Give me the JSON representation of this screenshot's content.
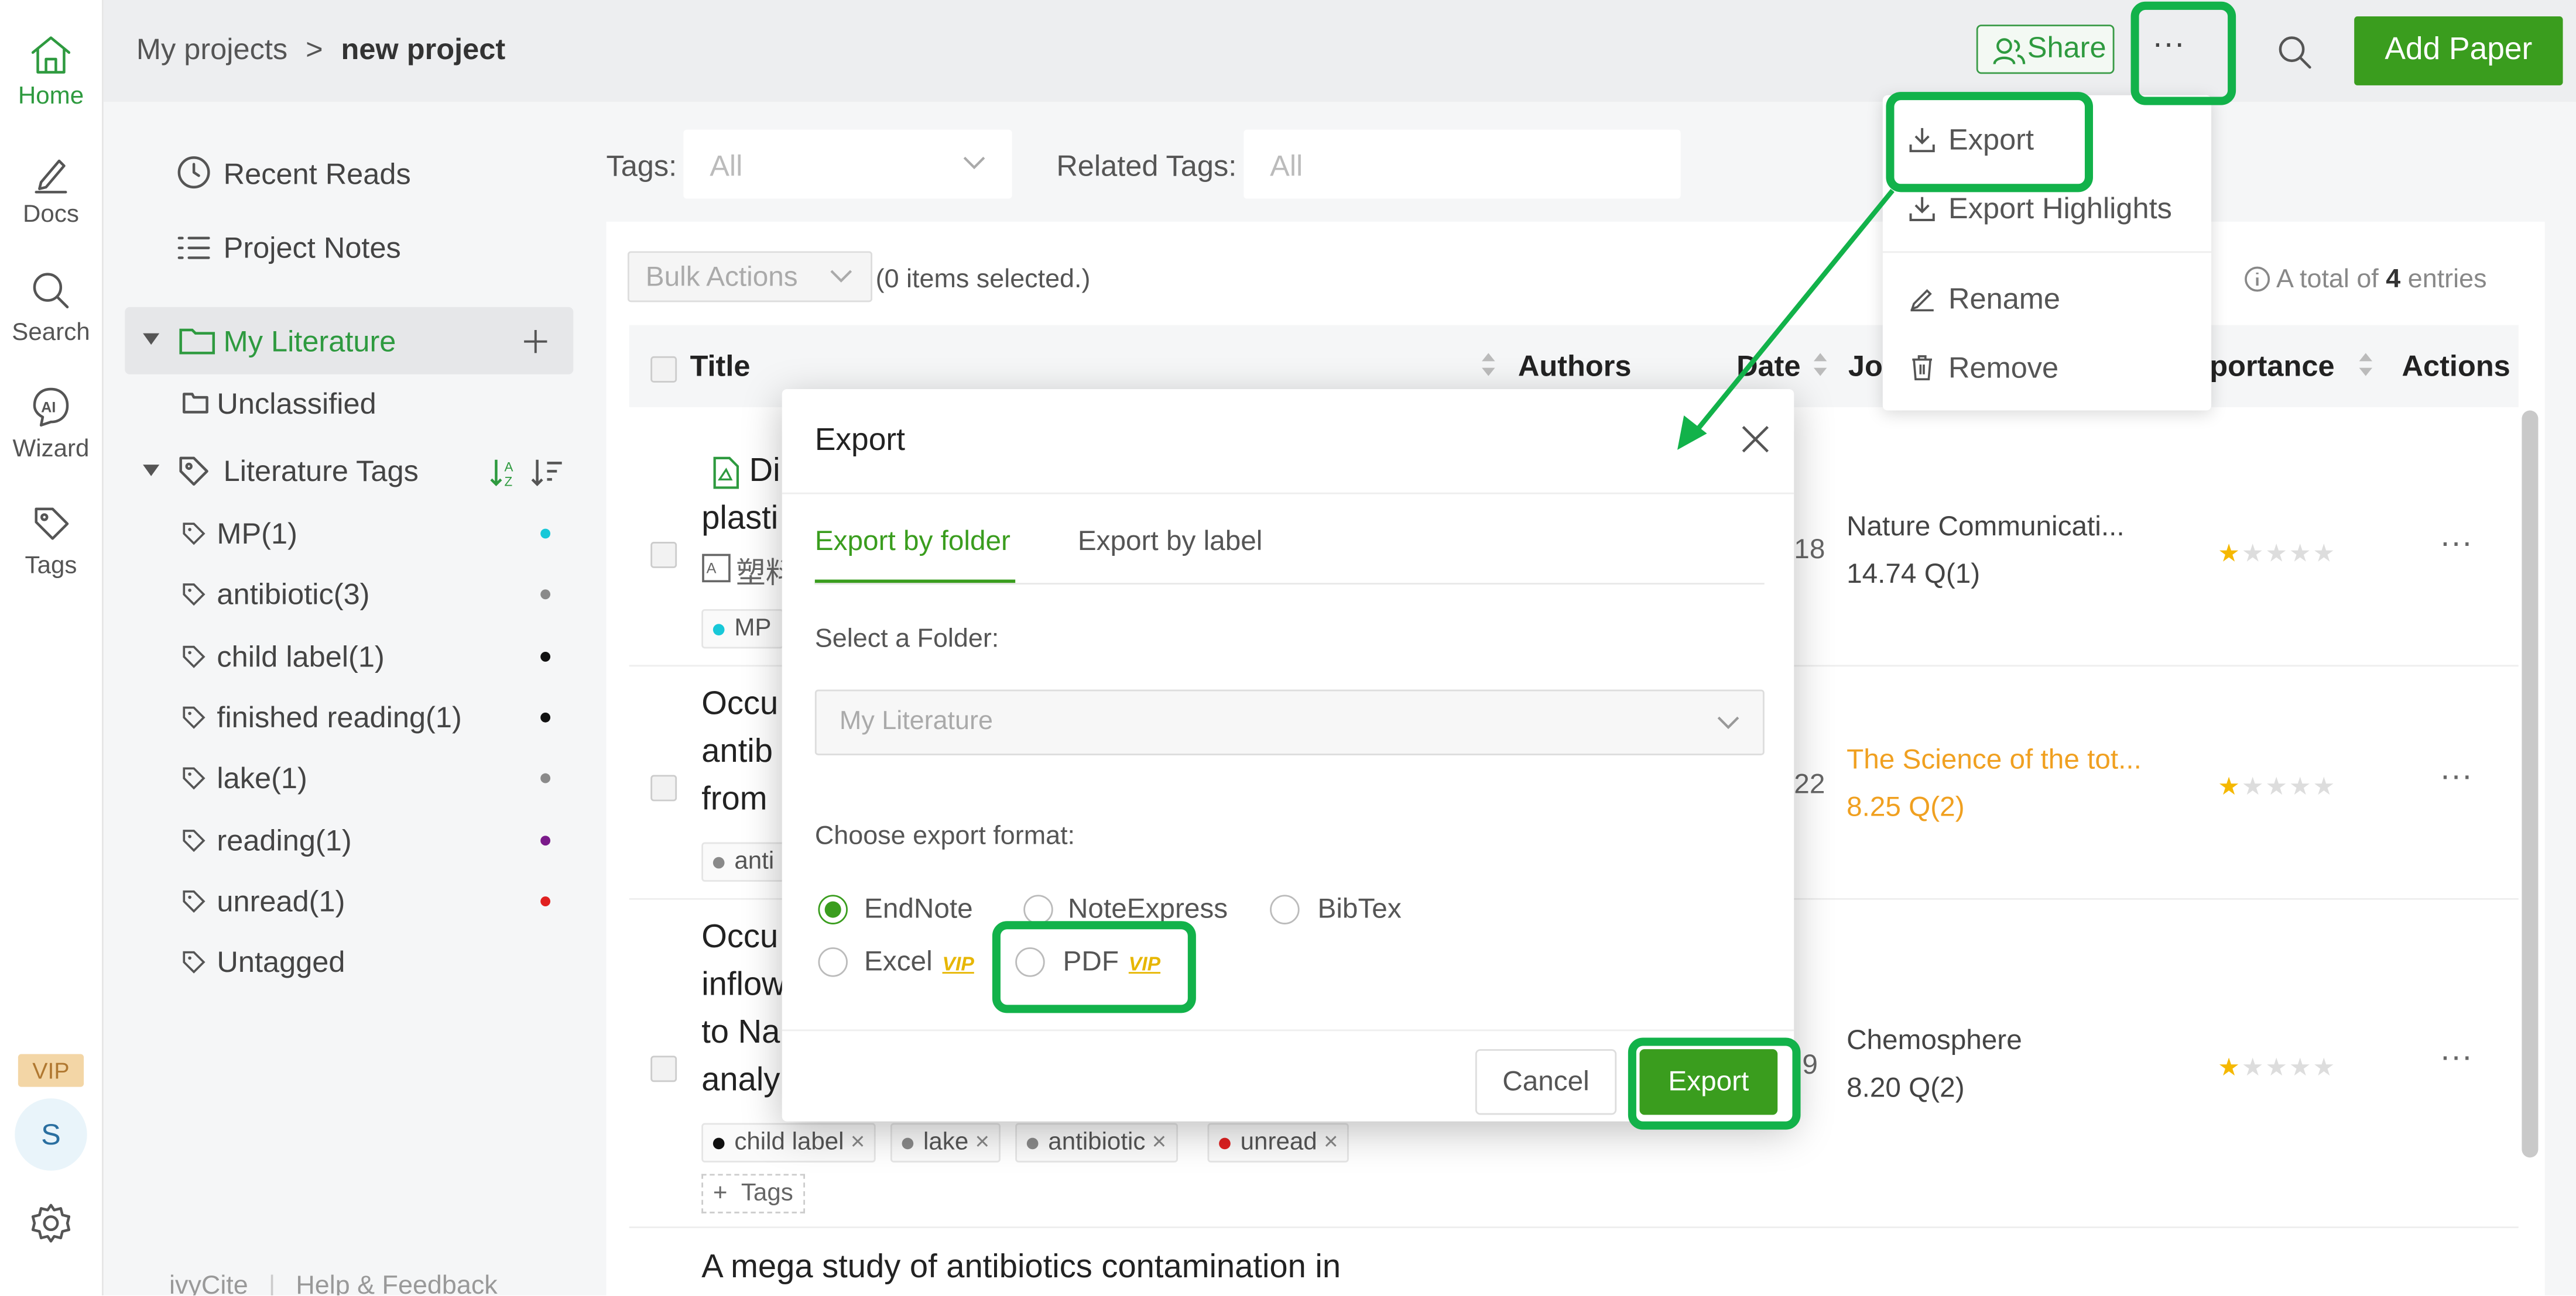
{
  "nav": {
    "home": "Home",
    "docs": "Docs",
    "search": "Search",
    "wizard": "Wizard",
    "tags": "Tags",
    "vip": "VIP",
    "avatar": "S"
  },
  "header": {
    "breadcrumb_root": "My projects",
    "breadcrumb_sep": ">",
    "breadcrumb_current": "new project",
    "share": "Share",
    "more": "···",
    "add_paper": "Add Paper"
  },
  "sidebar": {
    "recent_reads": "Recent Reads",
    "project_notes": "Project Notes",
    "my_literature": "My Literature",
    "unclassified": "Unclassified",
    "literature_tags": "Literature Tags",
    "tags": [
      {
        "label": "MP(1)",
        "color": "#18c8d8"
      },
      {
        "label": "antibiotic(3)",
        "color": "#8a8a8a"
      },
      {
        "label": "child label(1)",
        "color": "#111111"
      },
      {
        "label": "finished reading(1)",
        "color": "#111111"
      },
      {
        "label": "lake(1)",
        "color": "#8a8a8a"
      },
      {
        "label": "reading(1)",
        "color": "#7a1a8a"
      },
      {
        "label": "unread(1)",
        "color": "#e02020"
      },
      {
        "label": "Untagged",
        "color": ""
      }
    ],
    "footer_brand": "ivyCite",
    "footer_sep": "|",
    "footer_help": "Help & Feedback"
  },
  "filters": {
    "tags_label": "Tags:",
    "tags_value": "All",
    "related_label": "Related Tags:",
    "related_placeholder": "All"
  },
  "table": {
    "bulk_actions": "Bulk Actions",
    "selected": "(0 items selected.)",
    "total_prefix": "A total of",
    "total_count": "4",
    "total_suffix": "entries",
    "col_title": "Title",
    "col_authors": "Authors",
    "col_date": "Date",
    "col_journal": "Jo",
    "col_importance": "portance",
    "col_actions": "Actions",
    "rows": [
      {
        "t1": "Di",
        "t2": "plasti",
        "t3": "塑料",
        "date": "18",
        "journal": "Nature Communicati...",
        "metric": "14.74 Q(1)",
        "stars": 1
      },
      {
        "t1": "Occu",
        "t2": "antib",
        "t3": "from",
        "date": "22",
        "journal": "The Science of the tot...",
        "metric": "8.25 Q(2)",
        "stars": 1
      },
      {
        "t1": "Occu",
        "t2": "inflow",
        "t3": "to Na",
        "t4": "analy",
        "date": "9",
        "journal": "Chemosphere",
        "metric": "8.20 Q(2)",
        "stars": 1
      },
      {
        "t1": "A mega study of antibiotics contamination in"
      }
    ],
    "chips_row1": "MP",
    "chips_row2": "anti",
    "chips_row3": [
      "child label",
      "lake",
      "antibiotic",
      "unread"
    ],
    "add_tags": "Tags",
    "chip_close": "×"
  },
  "menu": {
    "export": "Export",
    "export_highlights": "Export Highlights",
    "rename": "Rename",
    "remove": "Remove"
  },
  "dialog": {
    "title": "Export",
    "tab_folder": "Export by folder",
    "tab_label": "Export by label",
    "select_folder_label": "Select a Folder:",
    "folder_placeholder": "My Literature",
    "format_label": "Choose export format:",
    "formats": [
      "EndNote",
      "NoteExpress",
      "BibTex",
      "Excel",
      "PDF"
    ],
    "vip_badge": "VIP",
    "cancel": "Cancel",
    "export": "Export"
  },
  "colors": {
    "accent": "#3a9d1e",
    "highlight": "#12b24a",
    "journal_orange": "#f0a020"
  }
}
